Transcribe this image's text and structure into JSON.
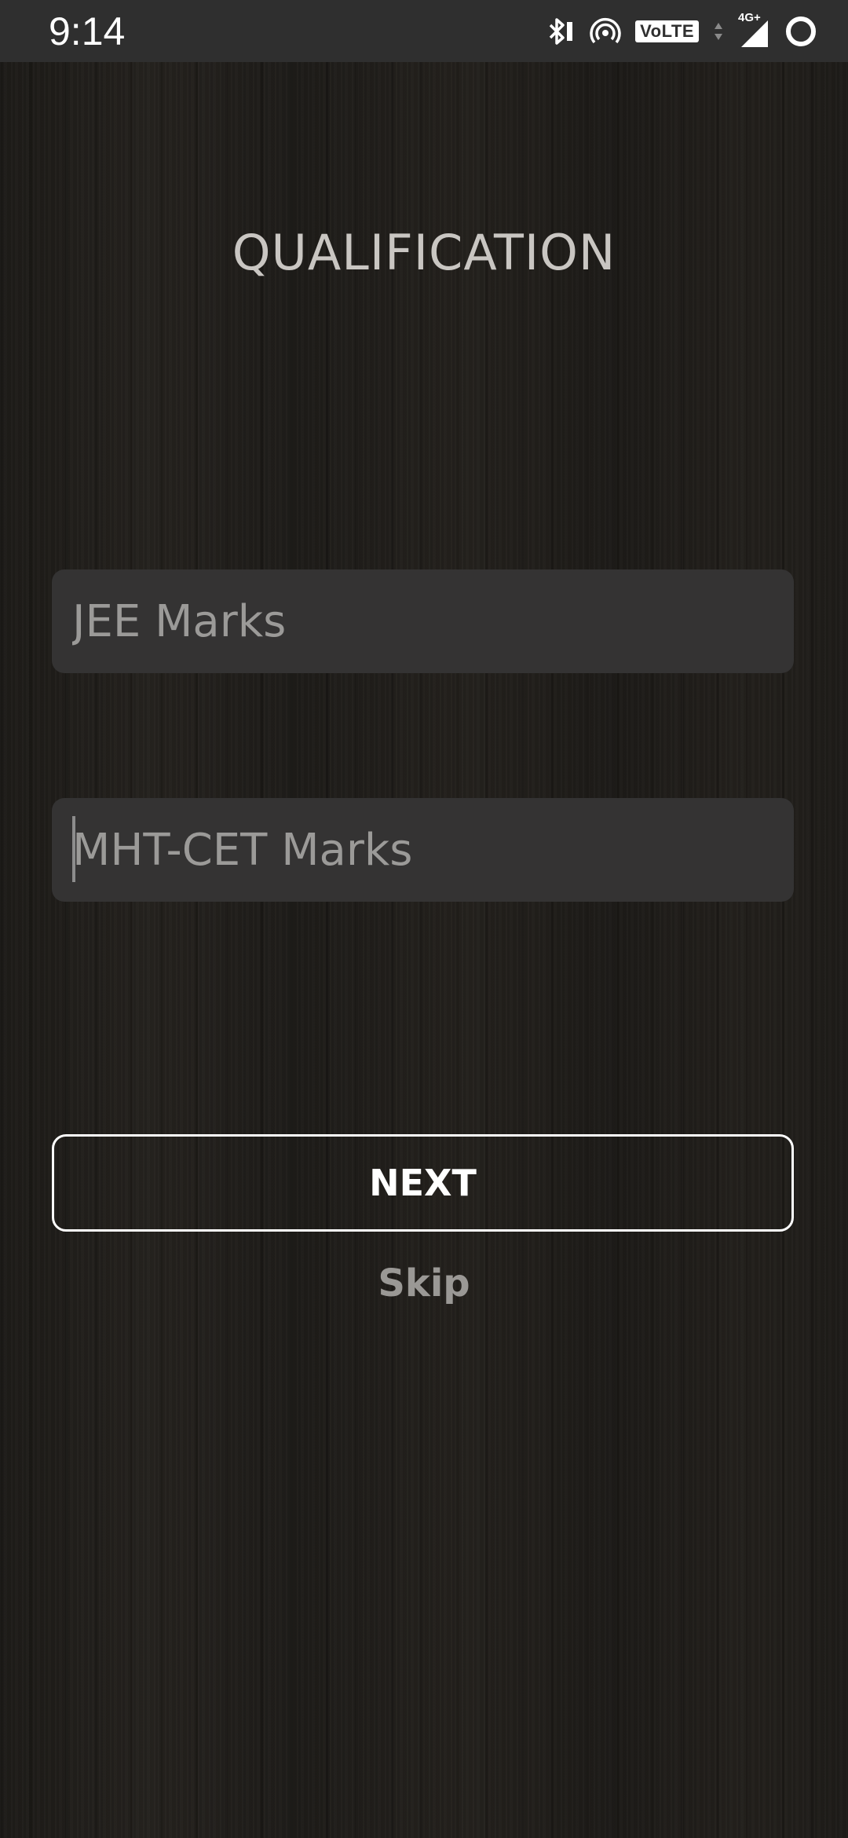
{
  "status_bar": {
    "time": "9:14",
    "network_type": "4G+",
    "volte_label": "VoLTE",
    "icons": [
      "bluetooth-icon",
      "hotspot-icon",
      "volte-icon",
      "data-arrows-icon",
      "signal-icon",
      "battery-ring-icon"
    ]
  },
  "page": {
    "title": "QUALIFICATION"
  },
  "form": {
    "jee_placeholder": "JEE Marks",
    "jee_value": "",
    "mht_cet_placeholder": "MHT-CET Marks",
    "mht_cet_value": ""
  },
  "actions": {
    "next_label": "NEXT",
    "skip_label": "Skip"
  },
  "colors": {
    "status_bar_bg": "#2f2f2f",
    "title_text": "#c9c6c2",
    "field_bg": "#343333",
    "placeholder": "#9b9a98",
    "button_border": "#ffffff",
    "skip_text": "#9a9895"
  }
}
